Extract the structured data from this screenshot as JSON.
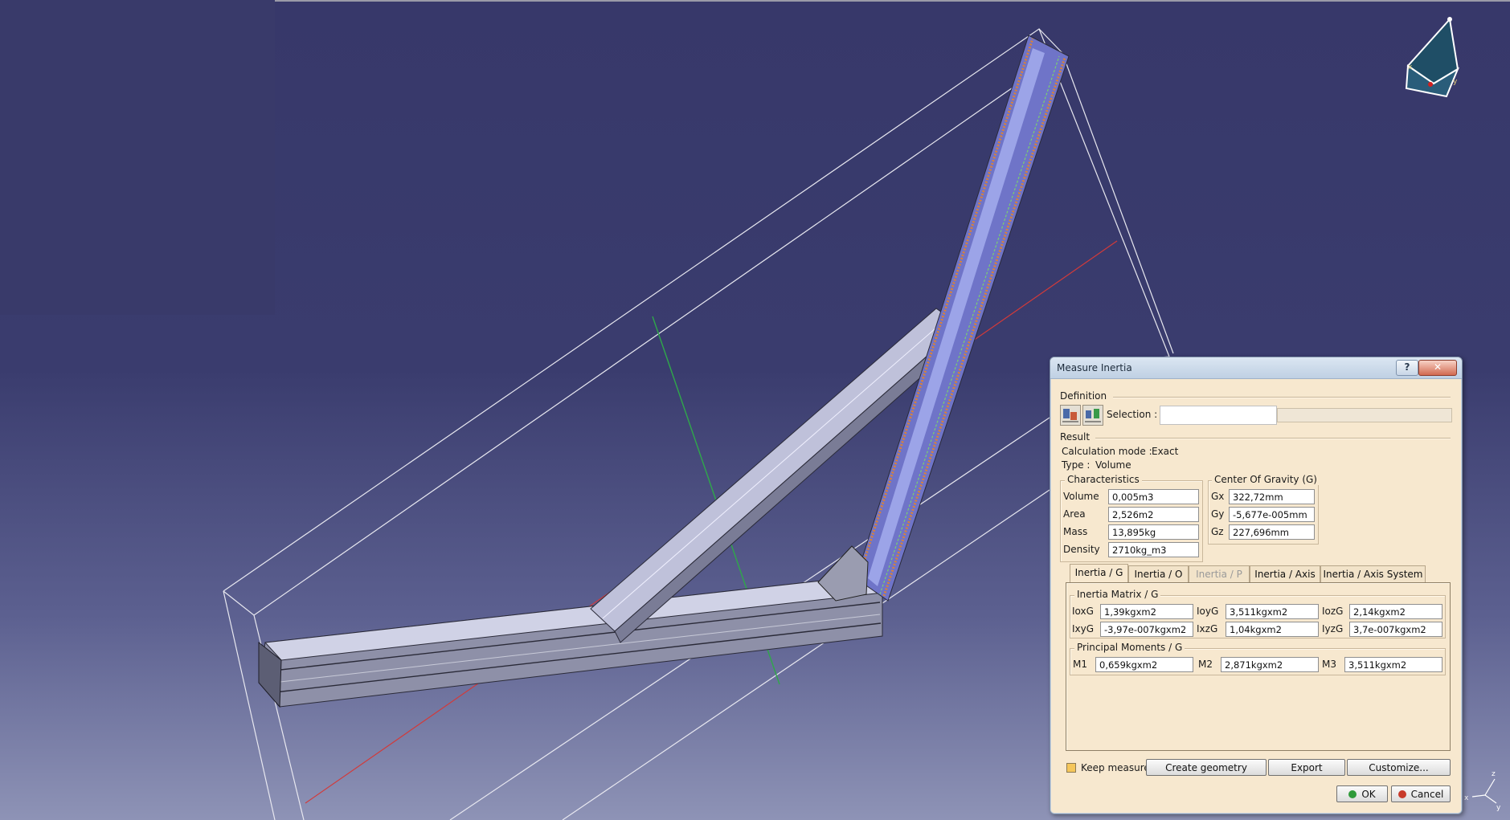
{
  "dialog": {
    "title": "Measure Inertia",
    "help_label": "?",
    "close_label": "✕",
    "definition_label": "Definition",
    "selection_label": "Selection :",
    "selection_value": "",
    "result_label": "Result",
    "calc_mode_label": "Calculation mode :",
    "calc_mode_value": "Exact",
    "type_label": "Type :",
    "type_value": "Volume",
    "characteristics": {
      "title": "Characteristics",
      "rows": [
        {
          "label": "Volume",
          "value": "0,005m3"
        },
        {
          "label": "Area",
          "value": "2,526m2"
        },
        {
          "label": "Mass",
          "value": "13,895kg"
        },
        {
          "label": "Density",
          "value": "2710kg_m3"
        }
      ]
    },
    "center_of_gravity": {
      "title": "Center Of Gravity (G)",
      "rows": [
        {
          "label": "Gx",
          "value": "322,72mm"
        },
        {
          "label": "Gy",
          "value": "-5,677e-005mm"
        },
        {
          "label": "Gz",
          "value": "227,696mm"
        }
      ]
    },
    "tabs": [
      {
        "label": "Inertia / G",
        "state": "active"
      },
      {
        "label": "Inertia / O",
        "state": "normal"
      },
      {
        "label": "Inertia / P",
        "state": "disabled"
      },
      {
        "label": "Inertia / Axis",
        "state": "normal"
      },
      {
        "label": "Inertia / Axis System",
        "state": "normal"
      }
    ],
    "inertia_matrix": {
      "title": "Inertia Matrix / G",
      "row1": [
        {
          "label": "IoxG",
          "value": "1,39kgxm2"
        },
        {
          "label": "IoyG",
          "value": "3,511kgxm2"
        },
        {
          "label": "IozG",
          "value": "2,14kgxm2"
        }
      ],
      "row2": [
        {
          "label": "IxyG",
          "value": "-3,97e-007kgxm2"
        },
        {
          "label": "IxzG",
          "value": "1,04kgxm2"
        },
        {
          "label": "IyzG",
          "value": "3,7e-007kgxm2"
        }
      ]
    },
    "principal_moments": {
      "title": "Principal Moments / G",
      "row": [
        {
          "label": "M1",
          "value": "0,659kgxm2"
        },
        {
          "label": "M2",
          "value": "2,871kgxm2"
        },
        {
          "label": "M3",
          "value": "3,511kgxm2"
        }
      ]
    },
    "keep_measure_label": "Keep measure",
    "create_geometry_label": "Create geometry",
    "export_label": "Export",
    "customize_label": "Customize...",
    "ok_label": "OK",
    "cancel_label": "Cancel"
  },
  "compass_axis_labels": {
    "x": "x",
    "y": "y",
    "z": "z"
  },
  "colors": {
    "background_top": "#37386a",
    "dialog_bg": "#f7e8cf",
    "bounding_box": "#e8e8f0",
    "axis_red": "#d23a3a",
    "axis_green": "#2fa84a"
  }
}
